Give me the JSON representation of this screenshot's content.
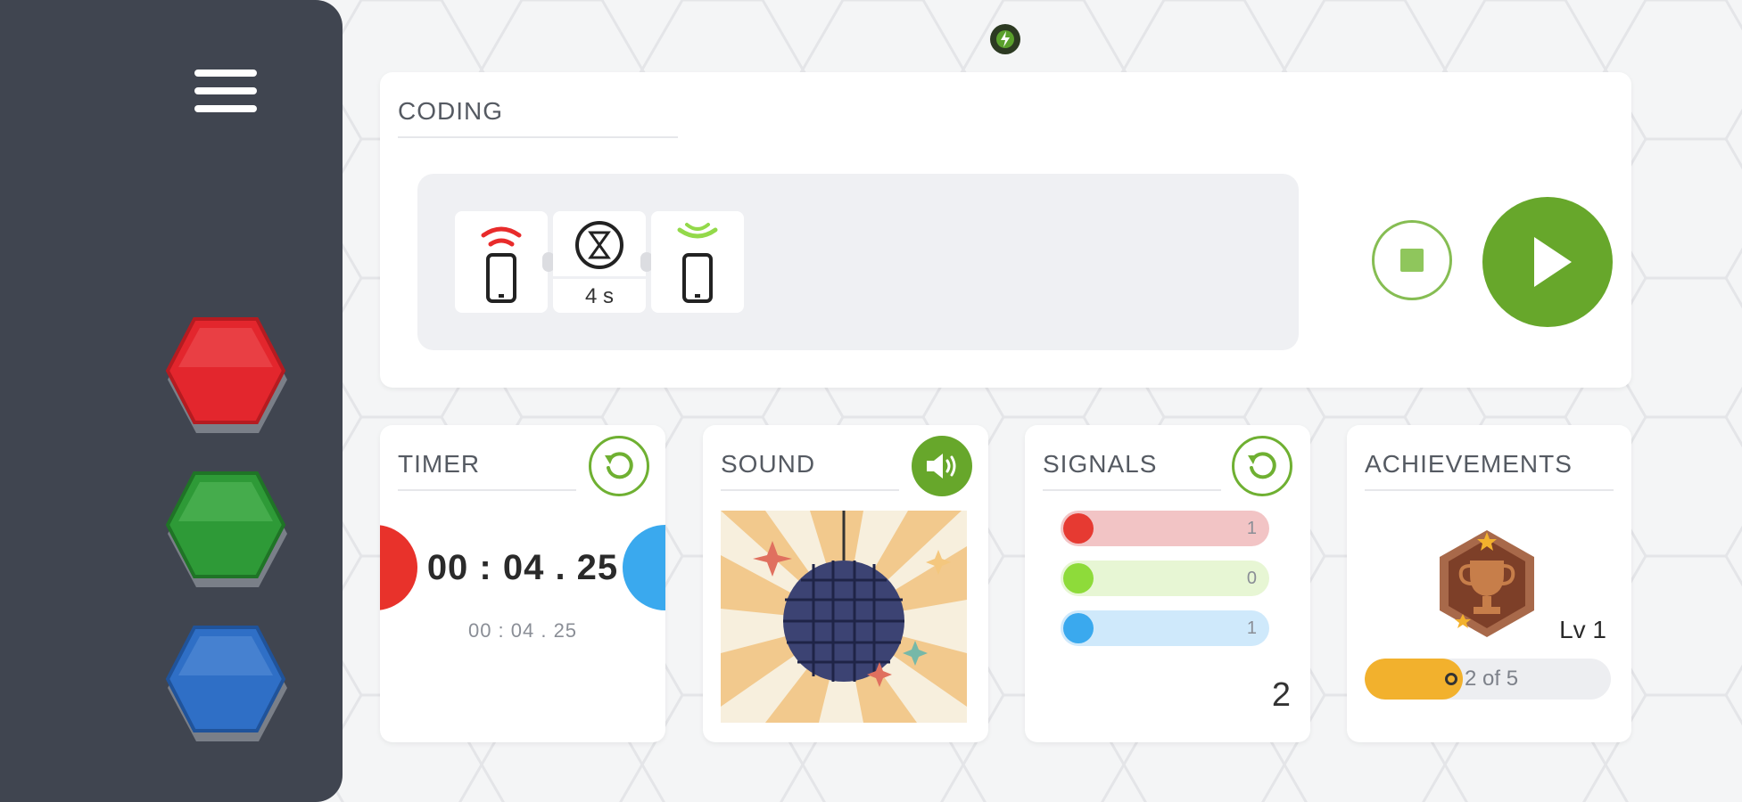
{
  "coding": {
    "title": "CODING",
    "blocks": [
      {
        "icon": "phone-send-icon"
      },
      {
        "icon": "wait-icon",
        "value": "4 s"
      },
      {
        "icon": "phone-receive-icon"
      }
    ]
  },
  "timer": {
    "title": "TIMER",
    "display": "00 : 04 . 25",
    "sub_display": "00 : 04 . 25"
  },
  "sound": {
    "title": "SOUND"
  },
  "signals": {
    "title": "SIGNALS",
    "rows": [
      {
        "color": "#e63a32",
        "track": "#f2c4c5",
        "value": "1"
      },
      {
        "color": "#8edb3a",
        "track": "#e7f6d4",
        "value": "0"
      },
      {
        "color": "#3aa9ee",
        "track": "#cfe9fb",
        "value": "1"
      }
    ],
    "total": "2"
  },
  "achievements": {
    "title": "ACHIEVEMENTS",
    "level": "Lv 1",
    "progress_text": "2 of 5",
    "progress_fraction": 0.4
  },
  "colors": {
    "sidebar": "#404550",
    "accent_green": "#67a72b",
    "hex_red": "#e3262d",
    "hex_green": "#2e9a37",
    "hex_blue": "#2f6fc6"
  }
}
